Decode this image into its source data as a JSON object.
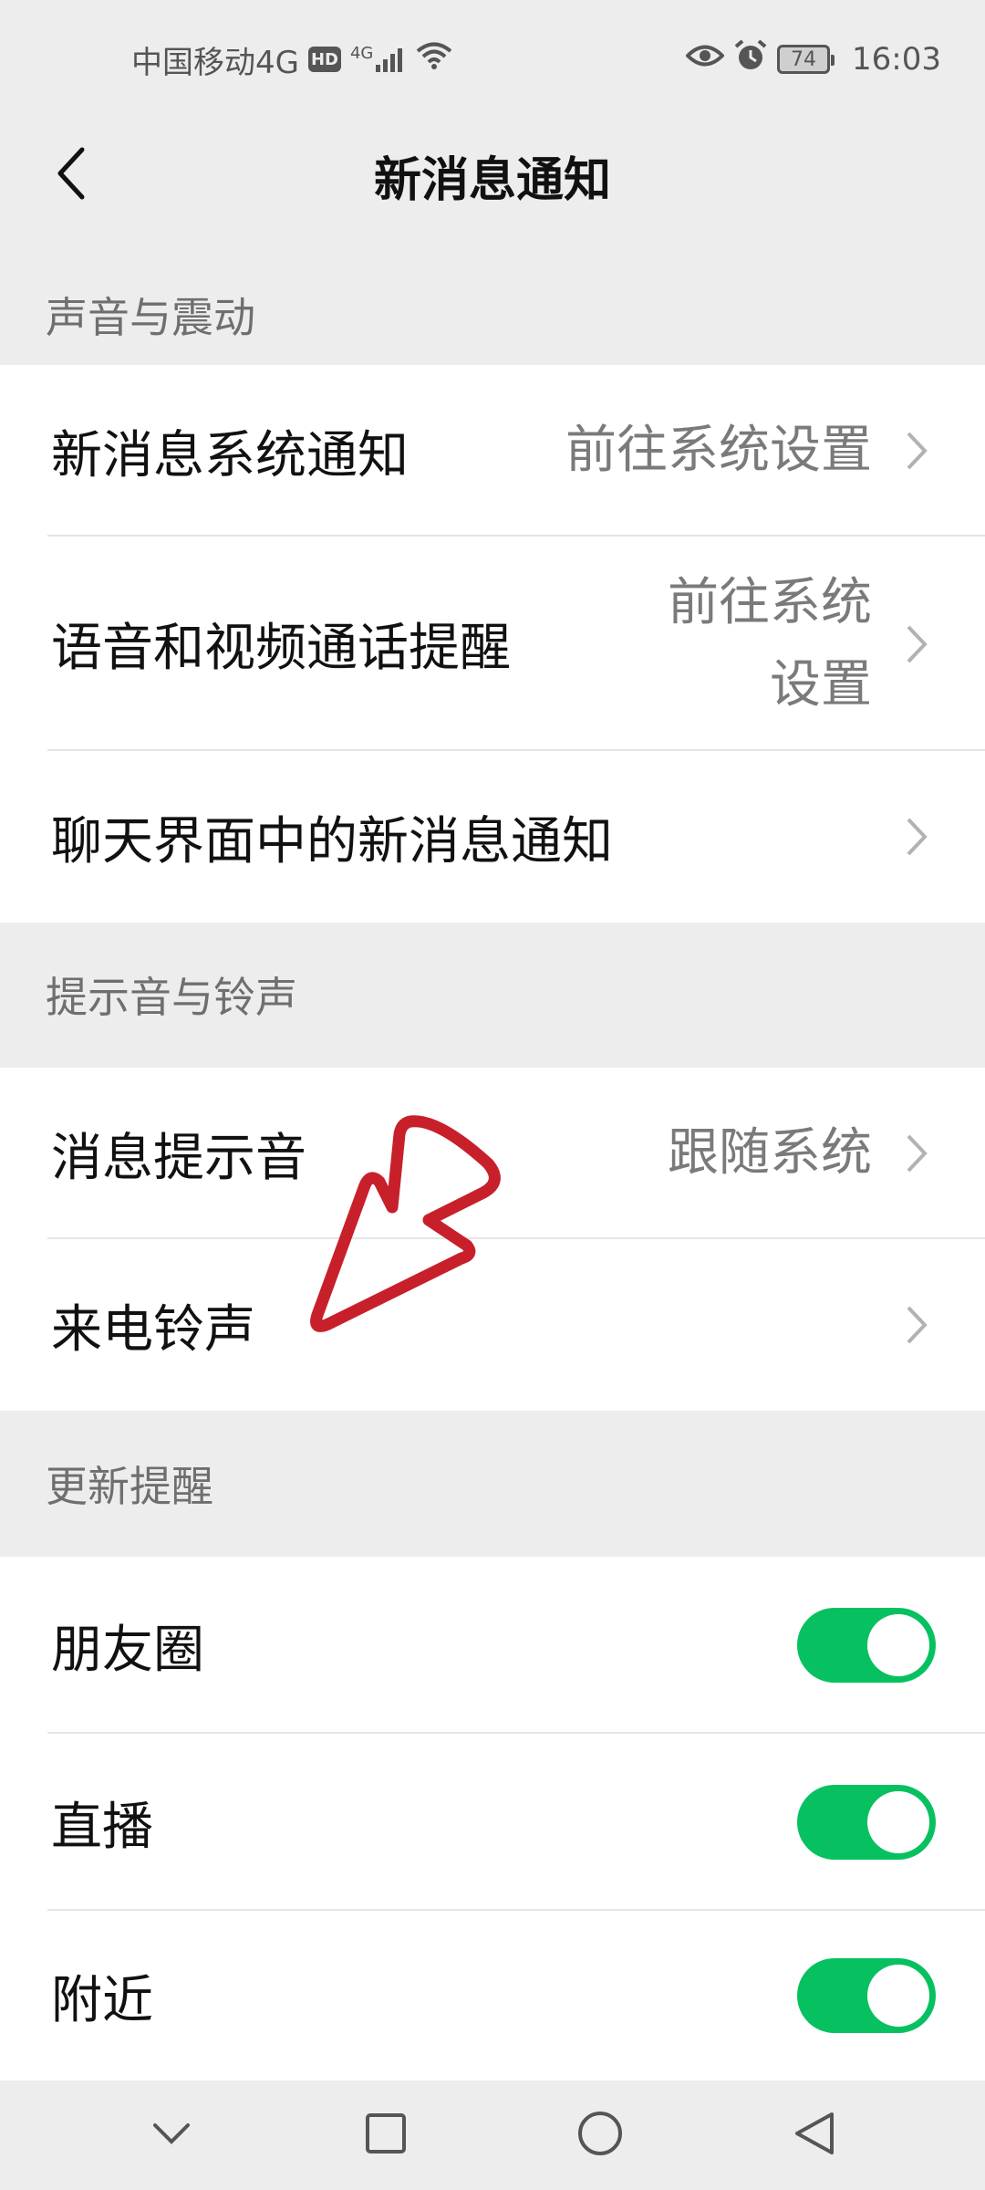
{
  "status_bar": {
    "carrier": "中国移动4G",
    "hd": "HD",
    "network": "4G",
    "battery": "74",
    "time": "16:03"
  },
  "header": {
    "title": "新消息通知"
  },
  "sections": {
    "sound_vibration": {
      "title": "声音与震动",
      "rows": [
        {
          "label": "新消息系统通知",
          "value": "前往系统设置"
        },
        {
          "label": "语音和视频通话提醒",
          "value": "前往系统设置"
        },
        {
          "label": "聊天界面中的新消息通知",
          "value": ""
        }
      ]
    },
    "tones": {
      "title": "提示音与铃声",
      "rows": [
        {
          "label": "消息提示音",
          "value": "跟随系统"
        },
        {
          "label": "来电铃声",
          "value": ""
        }
      ]
    },
    "updates": {
      "title": "更新提醒",
      "rows": [
        {
          "label": "朋友圈",
          "enabled": true
        },
        {
          "label": "直播",
          "enabled": true
        },
        {
          "label": "附近",
          "enabled": true
        }
      ]
    }
  },
  "colors": {
    "accent": "#07c160",
    "annotation": "#c8202a",
    "background": "#ededed"
  },
  "icons": {
    "back": "chevron-left-icon",
    "row_arrow": "chevron-right-icon",
    "nav": [
      "chevron-down-icon",
      "square-icon",
      "circle-icon",
      "triangle-back-icon"
    ]
  }
}
